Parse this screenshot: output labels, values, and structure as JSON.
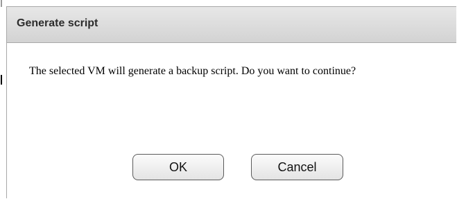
{
  "dialog": {
    "title": "Generate script",
    "message": "The selected VM will generate a backup script. Do you want to continue?",
    "buttons": {
      "ok_label": "OK",
      "cancel_label": "Cancel"
    }
  },
  "colors": {
    "titlebar_top": "#e7e7e7",
    "titlebar_bottom": "#d3d3d3",
    "button_border": "#5a5a5a"
  }
}
